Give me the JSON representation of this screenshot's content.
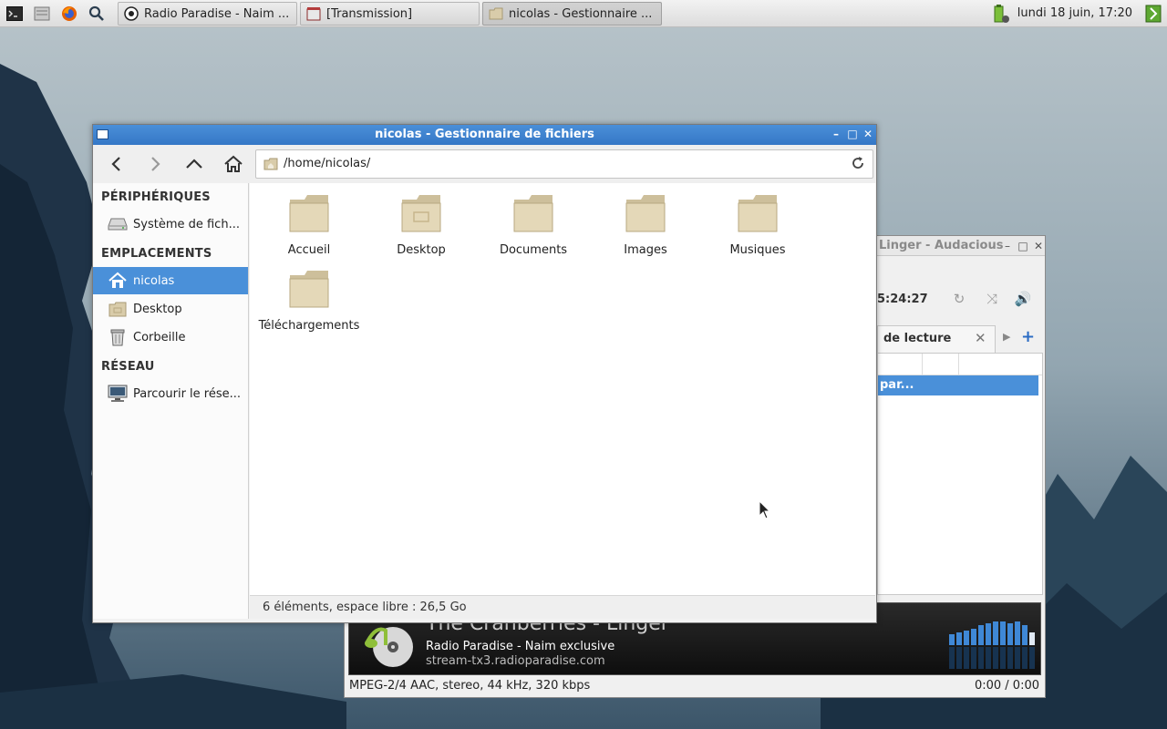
{
  "panel": {
    "launchers": [
      "terminal-icon",
      "file-manager-icon",
      "firefox-icon",
      "search-icon"
    ],
    "tasks": [
      {
        "label": "Radio Paradise - Naim ...",
        "icon": "audacious-icon",
        "active": false
      },
      {
        "label": "[Transmission]",
        "icon": "transmission-icon",
        "active": false
      },
      {
        "label": "nicolas - Gestionnaire ...",
        "icon": "folder-icon",
        "active": true
      }
    ],
    "clock": "lundi 18 juin, 17:20"
  },
  "audacious": {
    "title": "Linger - Audacious",
    "time": "5:24:27",
    "tab_label": "de lecture",
    "playlist_row": "par...",
    "now_playing": "The Cranberries - Linger",
    "station": "Radio Paradise - Naim exclusive",
    "stream": "stream-tx3.radioparadise.com",
    "codec": "MPEG-2/4 AAC, stereo, 44 kHz, 320 kbps",
    "position": "0:00 / 0:00"
  },
  "file_manager": {
    "title": "nicolas - Gestionnaire de fichiers",
    "path": "/home/nicolas/",
    "sidebar": {
      "devices_header": "PÉRIPHÉRIQUES",
      "devices": [
        {
          "label": "Système de fich...",
          "icon": "drive-icon"
        }
      ],
      "places_header": "EMPLACEMENTS",
      "places": [
        {
          "label": "nicolas",
          "icon": "home-icon",
          "selected": true
        },
        {
          "label": "Desktop",
          "icon": "desktop-folder-icon",
          "selected": false
        },
        {
          "label": "Corbeille",
          "icon": "trash-icon",
          "selected": false
        }
      ],
      "network_header": "RÉSEAU",
      "network": [
        {
          "label": "Parcourir le rése...",
          "icon": "network-icon"
        }
      ]
    },
    "folders": [
      "Accueil",
      "Desktop",
      "Documents",
      "Images",
      "Musiques",
      "Téléchargements"
    ],
    "status": "6 éléments, espace libre : 26,5 Go"
  },
  "colors": {
    "selection": "#4a90d9",
    "titlebar": "#3f84d0",
    "folder": "#d9ccaa"
  }
}
